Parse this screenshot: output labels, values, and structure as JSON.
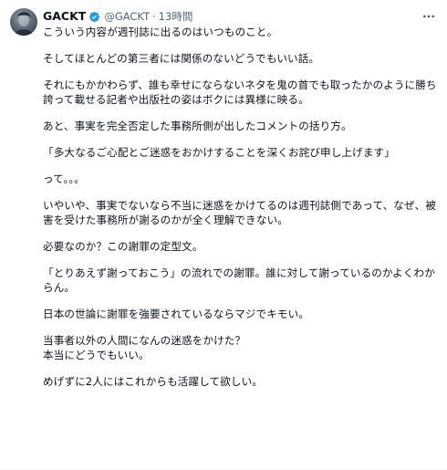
{
  "author": {
    "name": "GACKT",
    "handle": "@GACKT",
    "separator": "·",
    "time": "13時間",
    "verified_color": "#1d9bf0"
  },
  "icons": {
    "verified": "verified-badge-icon",
    "more": "more-dots-icon"
  },
  "tweet": {
    "paragraphs": [
      "こういう内容が週刊誌に出るのはいつものこと。",
      "そしてほとんどの第三者には関係のないどうでもいい話。",
      "それにもかかわらず、誰も幸せにならないネタを鬼の首でも取ったかのように勝ち誇って載せる記者や出版社の姿はボクには異様に映る。",
      "あと、事実を完全否定した事務所側が出したコメントの括り方。",
      "「多大なるご心配とご迷惑をおかけすることを深くお詫び申し上げます」",
      "って。。。",
      "いやいや、事実でないなら不当に迷惑をかけてるのは週刊誌側であって、なぜ、被害を受けた事務所が謝るのかが全く理解できない。",
      "必要なのか？この謝罪の定型文。",
      "「とりあえず謝っておこう」の流れでの謝罪。誰に対して謝っているのかよくわからん。",
      "日本の世論に謝罪を強要されているならマジでキモい。",
      "当事者以外の人間になんの迷惑をかけた？\n本当にどうでもいい。",
      "めげずに2人にはこれからも活躍して欲しい。"
    ]
  }
}
